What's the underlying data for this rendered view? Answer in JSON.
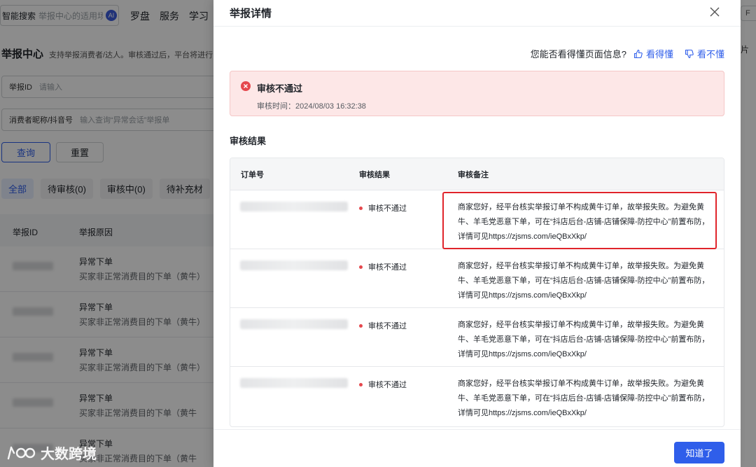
{
  "background": {
    "search": {
      "label": "智能搜索",
      "placeholder": "举报中心的适用场",
      "ai_badge": "AI"
    },
    "nav": [
      "罗盘",
      "服务",
      "学习"
    ],
    "page_title": "举报中心",
    "page_desc": "支持举报消费者/达人。审核通过后，平台将进行",
    "fields": [
      {
        "label": "举报ID",
        "placeholder": "请输入"
      },
      {
        "label": "消费者昵称/抖音号",
        "placeholder": "输入查询“异常会话”举报单"
      }
    ],
    "query_button": "查询",
    "reset_button": "重置",
    "tabs": [
      "全部",
      "待审核(0)",
      "审核中(0)",
      "待补充材"
    ],
    "list_columns": [
      "举报ID",
      "举报原因"
    ],
    "rows": [
      {
        "title": "异常下单",
        "sub": "买家非正常消费目的下单（黄牛）"
      },
      {
        "title": "异常下单",
        "sub": "买家非正常消费目的下单（黄牛）"
      },
      {
        "title": "异常下单",
        "sub": "买家非正常消费目的下单（黄牛）"
      },
      {
        "title": "异常下单",
        "sub": "买家非正常消费目的下单（黄牛"
      },
      {
        "title": "异常下单",
        "sub": "买家非正常消费目的下单（黄牛"
      }
    ],
    "right_edge_text": "片",
    "right_edge_box": "F"
  },
  "drawer": {
    "title": "举报详情",
    "feedback": {
      "question": "您能否看得懂页面信息?",
      "understand": "看得懂",
      "not_understand": "看不懂"
    },
    "alert": {
      "status": "审核不通过",
      "time_label": "审核时间：2024/08/03 16:32:38"
    },
    "section_title": "审核结果",
    "table": {
      "columns": [
        "订单号",
        "审核结果",
        "审核备注"
      ],
      "rows": [
        {
          "result": "审核不通过",
          "remark": "商家您好，经平台核实举报订单不构成黄牛订单，故举报失败。为避免黄牛、羊毛党恶意下单，可在“抖店后台-店铺-店铺保障-防控中心”前置布防，详情可见https://zjsms.com/ieQBxXkp/"
        },
        {
          "result": "审核不通过",
          "remark": "商家您好，经平台核实举报订单不构成黄牛订单，故举报失败。为避免黄牛、羊毛党恶意下单，可在“抖店后台-店铺-店铺保障-防控中心”前置布防，详情可见https://zjsms.com/ieQBxXkp/"
        },
        {
          "result": "审核不通过",
          "remark": "商家您好，经平台核实举报订单不构成黄牛订单，故举报失败。为避免黄牛、羊毛党恶意下单，可在“抖店后台-店铺-店铺保障-防控中心”前置布防，详情可见https://zjsms.com/ieQBxXkp/"
        },
        {
          "result": "审核不通过",
          "remark": "商家您好，经平台核实举报订单不构成黄牛订单，故举报失败。为避免黄牛、羊毛党恶意下单，可在“抖店后台-店铺-店铺保障-防控中心”前置布防，详情可见https://zjsms.com/ieQBxXkp/"
        }
      ]
    },
    "ok_button": "知道了"
  },
  "watermark": "大数跨境",
  "colors": {
    "primary": "#2f5eea",
    "error": "#e5484d",
    "alert_bg": "#fde7e7",
    "highlight": "#e0242b"
  }
}
